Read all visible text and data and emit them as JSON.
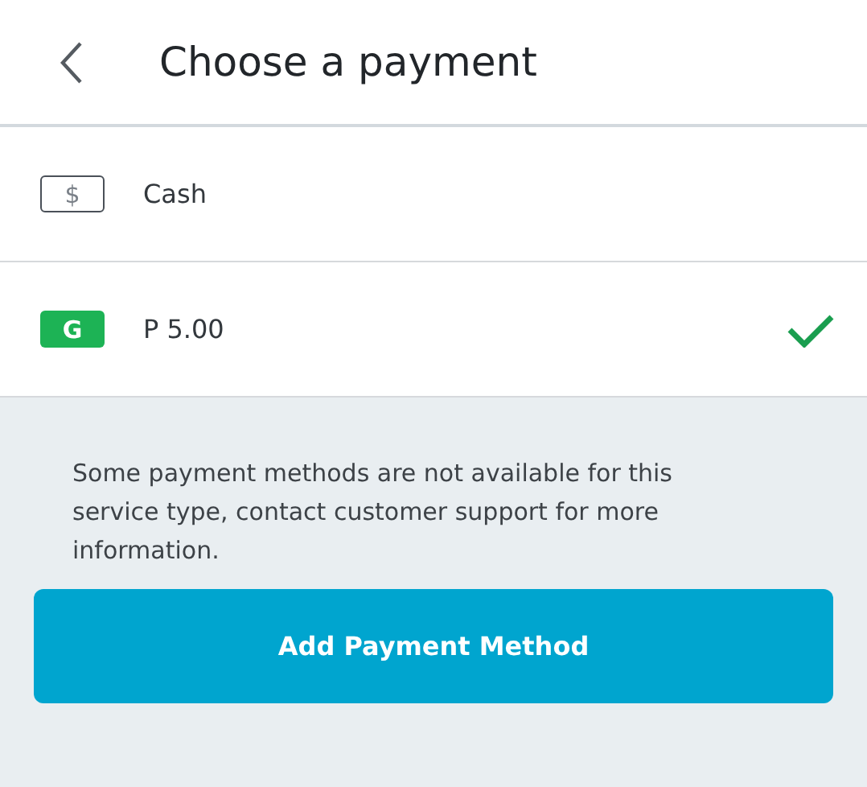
{
  "header": {
    "title": "Choose a payment"
  },
  "methods": [
    {
      "kind": "cash",
      "icon_text": "$",
      "label": "Cash",
      "selected": false
    },
    {
      "kind": "wallet",
      "icon_text": "G",
      "label": "P 5.00",
      "selected": true
    }
  ],
  "note": "Some payment methods are not available for this service type, contact customer support for more information.",
  "button": "Add Payment Method"
}
